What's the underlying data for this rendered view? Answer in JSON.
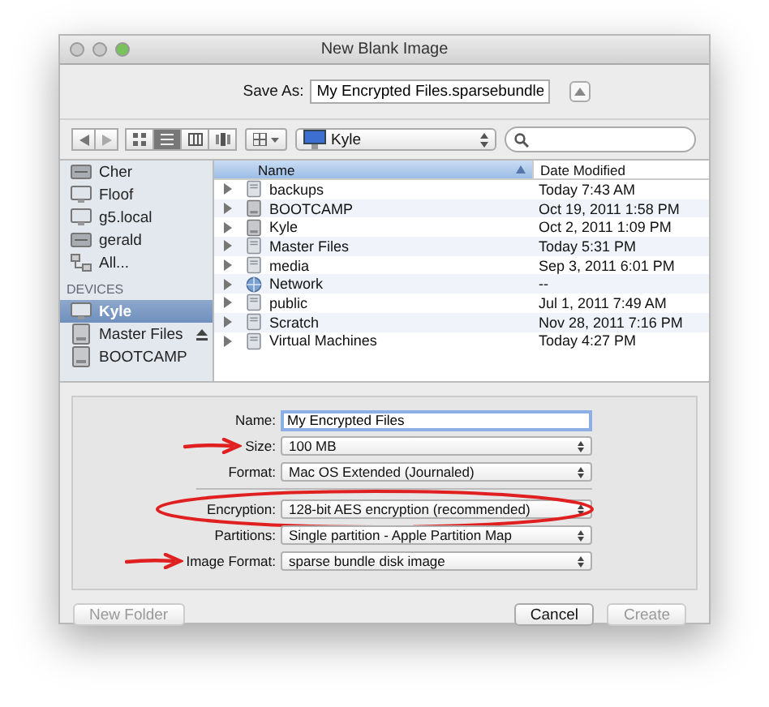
{
  "window": {
    "title": "New Blank Image"
  },
  "save_as": {
    "label": "Save As:",
    "value": "My Encrypted Files.sparsebundle",
    "expanded": false
  },
  "toolbar": {
    "view_modes": [
      {
        "kind": "icons",
        "selected": false
      },
      {
        "kind": "list",
        "selected": true
      },
      {
        "kind": "columns",
        "selected": false
      },
      {
        "kind": "coverflow",
        "selected": false
      }
    ],
    "location": "Kyle"
  },
  "sidebar": {
    "items": [
      {
        "kind": "server",
        "label": "Cher",
        "selected": false
      },
      {
        "kind": "display",
        "label": "Floof",
        "selected": false
      },
      {
        "kind": "display",
        "label": "g5.local",
        "selected": false
      },
      {
        "kind": "server",
        "label": "gerald",
        "selected": false
      },
      {
        "kind": "network",
        "label": "All...",
        "selected": false
      },
      {
        "kind": "heading",
        "label": "DEVICES"
      },
      {
        "kind": "display",
        "label": "Kyle",
        "selected": true
      },
      {
        "kind": "drive",
        "label": "Master Files",
        "selected": false,
        "eject": true
      },
      {
        "kind": "drive",
        "label": "BOOTCAMP",
        "selected": false
      }
    ]
  },
  "files": {
    "columns": [
      {
        "label": "Name",
        "selected": true
      },
      {
        "label": "Date Modified",
        "selected": false
      }
    ],
    "rows": [
      {
        "kind": "folder",
        "name": "backups",
        "date": "Today 7:43 AM"
      },
      {
        "kind": "drive",
        "name": "BOOTCAMP",
        "date": "Oct 19, 2011 1:58 PM"
      },
      {
        "kind": "drive",
        "name": "Kyle",
        "date": "Oct 2, 2011 1:09 PM"
      },
      {
        "kind": "folder",
        "name": "Master Files",
        "date": "Today 5:31 PM"
      },
      {
        "kind": "folder",
        "name": "media",
        "date": "Sep 3, 2011 6:01 PM"
      },
      {
        "kind": "network",
        "name": "Network",
        "date": "--"
      },
      {
        "kind": "folder",
        "name": "public",
        "date": "Jul 1, 2011 7:49 AM"
      },
      {
        "kind": "folder",
        "name": "Scratch",
        "date": "Nov 28, 2011 7:16 PM"
      },
      {
        "kind": "folder",
        "name": "Virtual Machines",
        "date": "Today 4:27 PM"
      }
    ]
  },
  "options": [
    {
      "kind": "field",
      "label": "Name:",
      "value": "My Encrypted Files"
    },
    {
      "kind": "popup",
      "label": "Size:",
      "value": "100 MB",
      "annotation": {
        "kind": "arrow"
      }
    },
    {
      "kind": "popup",
      "label": "Format:",
      "value": "Mac OS Extended (Journaled)"
    },
    {
      "kind": "separator"
    },
    {
      "kind": "popup",
      "label": "Encryption:",
      "value": "128-bit AES encryption (recommended)",
      "annotation": {
        "kind": "ellipse"
      }
    },
    {
      "kind": "popup",
      "label": "Partitions:",
      "value": "Single partition - Apple Partition Map"
    },
    {
      "kind": "popup",
      "label": "Image Format:",
      "value": "sparse bundle disk image",
      "annotation": {
        "kind": "arrow"
      }
    }
  ],
  "buttons": [
    {
      "label": "New Folder",
      "disabled": true
    },
    {
      "label": "Cancel",
      "disabled": false
    },
    {
      "label": "Create",
      "disabled": true
    }
  ]
}
